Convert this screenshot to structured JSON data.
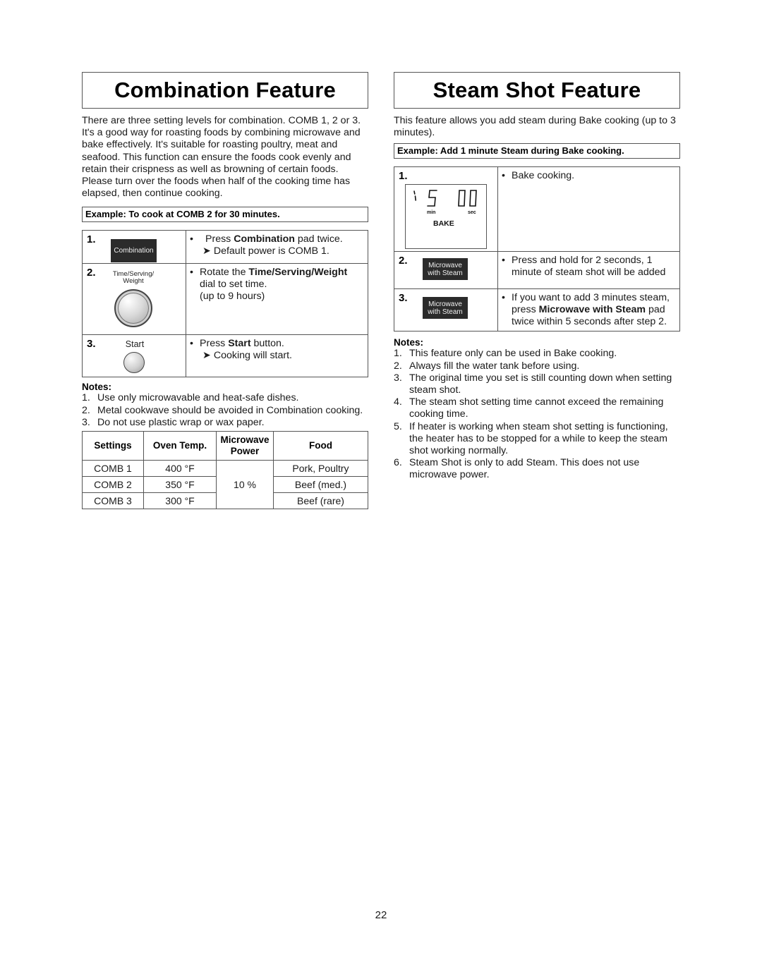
{
  "page_number": "22",
  "combination": {
    "title": "Combination Feature",
    "intro": "There are three setting levels for combination. COMB 1, 2 or 3. It's a good way for roasting foods by combining microwave and bake effectively. It's suitable for roasting poultry, meat and seafood. This function can ensure the foods cook evenly and retain their crispness  as well as browning of certain foods. Please turn over the foods when half of the cooking time has elapsed, then continue cooking.",
    "example": "Example: To cook at COMB 2 for 30 minutes.",
    "steps": [
      {
        "num": "1.",
        "pad_label": "Combination",
        "bullet": "•",
        "text_pre": "Press ",
        "text_bold": "Combination",
        "text_post": " pad twice.",
        "sub": "➤ Default power is COMB 1."
      },
      {
        "num": "2.",
        "dial_label_1": "Time/Serving/",
        "dial_label_2": "Weight",
        "bullet": "•",
        "text_pre": "Rotate the ",
        "text_bold": "Time/Serving/Weight",
        "line2": "dial to set time.",
        "line3": "(up to 9 hours)"
      },
      {
        "num": "3.",
        "button_label": "Start",
        "bullet": "•",
        "text_pre": "Press ",
        "text_bold": "Start",
        "text_post": " button.",
        "sub": "➤ Cooking will start."
      }
    ],
    "notes_title": "Notes:",
    "notes": [
      {
        "n": "1.",
        "text": "Use only microwavable and heat-safe dishes."
      },
      {
        "n": "2.",
        "text": "Metal cookwave should be avoided in Combination cooking."
      },
      {
        "n": "3.",
        "text": "Do not use plastic wrap or wax paper."
      }
    ],
    "table": {
      "headers": [
        "Settings",
        "Oven Temp.",
        "Microwave Power",
        "Food"
      ],
      "header_mw_1": "Microwave",
      "header_mw_2": "Power",
      "rows": [
        {
          "setting": "COMB 1",
          "temp": "400 °F",
          "food": "Pork, Poultry"
        },
        {
          "setting": "COMB 2",
          "temp": "350 °F",
          "food": "Beef (med.)"
        },
        {
          "setting": "COMB 3",
          "temp": "300 °F",
          "food": "Beef (rare)"
        }
      ],
      "power": "10 %"
    }
  },
  "steam": {
    "title": "Steam Shot Feature",
    "intro": "This feature allows you add steam during Bake cooking (up to 3 minutes).",
    "example": "Example: Add 1 minute Steam during Bake cooking.",
    "steps": [
      {
        "num": "1.",
        "display": {
          "digits_min": "5",
          "digits_sec": "00",
          "min_label": "min",
          "sec_label": "sec",
          "mode": "BAKE"
        },
        "bullet": "•",
        "text": "Bake cooking."
      },
      {
        "num": "2.",
        "pad_label_1": "Microwave",
        "pad_label_2": "with Steam",
        "bullet": "•",
        "line1": "Press and hold for 2 seconds, 1",
        "line2": "minute of steam shot will be added"
      },
      {
        "num": "3.",
        "pad_label_1": "Microwave",
        "pad_label_2": "with Steam",
        "bullet": "•",
        "line1": "If you want to add 3 minutes steam,",
        "line2_pre": "press ",
        "line2_bold": "Microwave with Steam",
        "line2_post": " pad",
        "line3": "twice within 5 seconds after step 2."
      }
    ],
    "notes_title": "Notes:",
    "notes": [
      {
        "n": "1.",
        "text": "This feature only can be used in Bake cooking."
      },
      {
        "n": "2.",
        "text": "Always fill the water tank before using."
      },
      {
        "n": "3.",
        "text": "The original time you set is still counting down when setting steam shot."
      },
      {
        "n": "4.",
        "text": "The steam shot setting time cannot exceed the remaining cooking time."
      },
      {
        "n": "5.",
        "text": "If heater is working when steam shot setting is functioning, the heater has to be stopped for a while to keep the steam shot working normally."
      },
      {
        "n": "6.",
        "text": "Steam Shot is only to add Steam. This does not use microwave power."
      }
    ]
  }
}
